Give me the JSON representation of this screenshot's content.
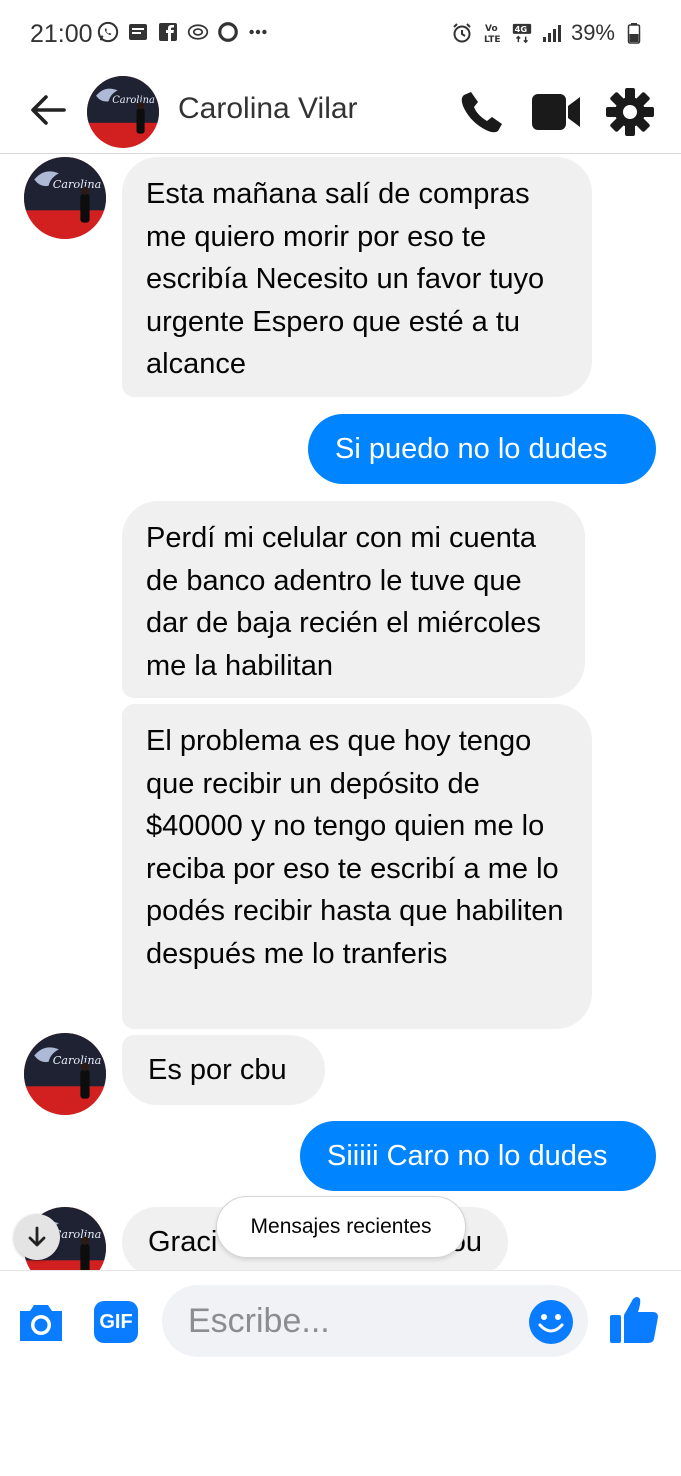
{
  "status_bar": {
    "time": "21:00",
    "left_icons": [
      "whatsapp-icon",
      "message-icon",
      "facebook-icon",
      "vpn-icon",
      "circle-icon",
      "more-dots-icon"
    ],
    "right_icons": [
      "alarm-icon",
      "volte-icon",
      "4g-icon",
      "signal-icon"
    ],
    "battery": "39%"
  },
  "header": {
    "contact_name": "Carolina Vilar"
  },
  "messages": [
    {
      "direction": "incoming",
      "text": "Esta mañana salí de compras me quiero morir por eso te escribía Necesito un favor tuyo urgente Espero que esté a tu alcance"
    },
    {
      "direction": "outgoing",
      "text": "Si puedo no lo dudes"
    },
    {
      "direction": "incoming",
      "text": "Perdí mi celular con mi cuenta de banco adentro le tuve que dar de baja recién el miércoles me la habilitan"
    },
    {
      "direction": "incoming",
      "text": "El problema es que hoy tengo que recibir un depósito de $40000 y no tengo quien me lo reciba por eso te escribí a me lo podés recibir hasta que habiliten después me lo tranferis"
    },
    {
      "direction": "incoming",
      "text": "Es por cbu"
    },
    {
      "direction": "outgoing",
      "text": "Siiiii Caro no lo dudes"
    },
    {
      "direction": "incoming",
      "text": "Graci",
      "tail_text": "ou"
    }
  ],
  "recent_messages_label": "Mensajes recientes",
  "composer": {
    "gif_label": "GIF",
    "placeholder": "Escribe..."
  },
  "colors": {
    "accent": "#0084ff",
    "incoming_bubble": "#f0f0f0",
    "avatar_red": "#d21f1f"
  }
}
